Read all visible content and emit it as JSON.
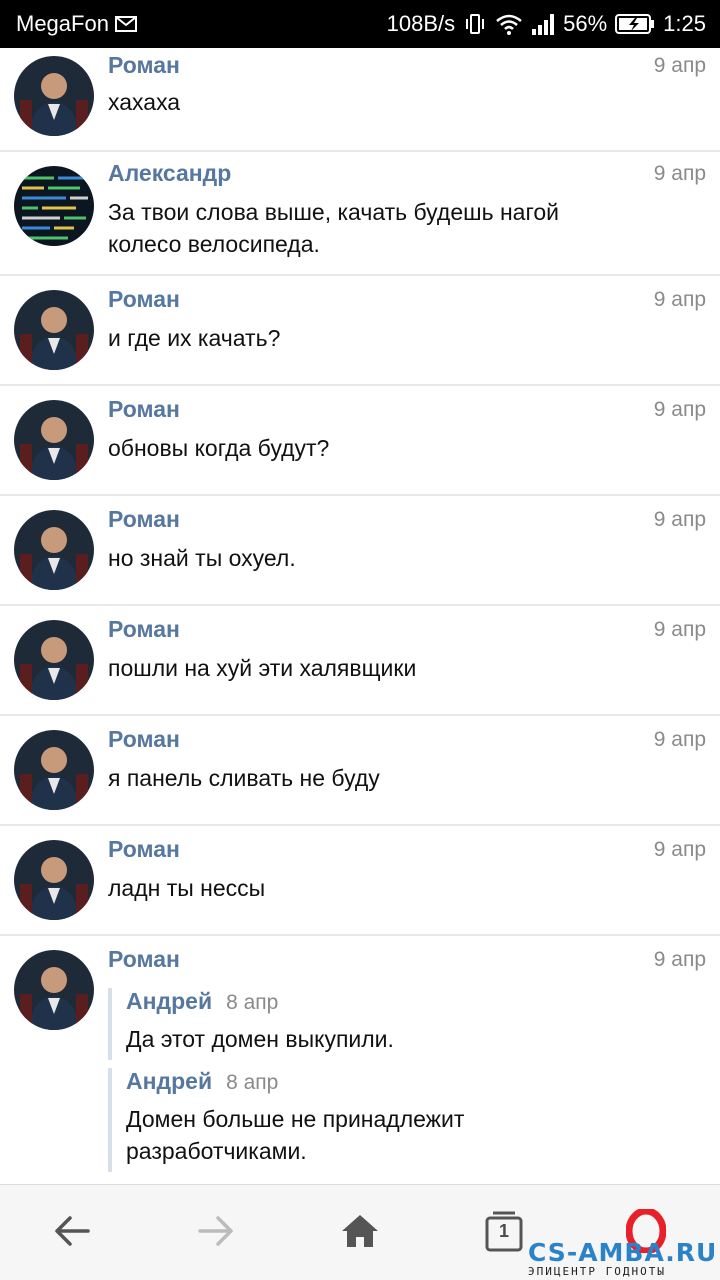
{
  "status_bar": {
    "carrier": "MegaFon",
    "speed": "108B/s",
    "battery": "56%",
    "time": "1:25"
  },
  "messages": [
    {
      "author": "Роман",
      "date": "9 апр",
      "text": "хахаха"
    },
    {
      "author": "Александр",
      "date": "9 апр",
      "text": "За твои слова выше, качать будешь нагой колесо велосипеда."
    },
    {
      "author": "Роман",
      "date": "9 апр",
      "text": "и где их качать?"
    },
    {
      "author": "Роман",
      "date": "9 апр",
      "text": "обновы когда будут?"
    },
    {
      "author": "Роман",
      "date": "9 апр",
      "text": "но знай ты охуел."
    },
    {
      "author": "Роман",
      "date": "9 апр",
      "text": "пошли на хуй эти халявщики"
    },
    {
      "author": "Роман",
      "date": "9 апр",
      "text": "я панель сливать не буду"
    },
    {
      "author": "Роман",
      "date": "9 апр",
      "text": "ладн ты нессы"
    },
    {
      "author": "Роман",
      "date": "9 апр",
      "quotes": [
        {
          "author": "Андрей",
          "date": "8 апр",
          "text": "Да этот домен выкупили."
        },
        {
          "author": "Андрей",
          "date": "8 апр",
          "text": "Домен больше не принадлежит разработчиками."
        }
      ]
    }
  ],
  "bottom_nav": {
    "tabs_count": "1",
    "browser_logo": "O"
  },
  "watermark": {
    "main": "CS-AMBA.RU",
    "sub": "ЭПИЦЕНТР ГОДНОТЫ"
  },
  "icons": [
    "mail-icon",
    "vibrate-icon",
    "wifi-icon",
    "signal-icon",
    "battery-icon",
    "back-arrow-icon",
    "forward-arrow-icon",
    "home-icon",
    "tabs-icon",
    "opera-logo-icon"
  ],
  "colors": {
    "author": "#56779f",
    "date": "#8a8a8a",
    "status_bar": "#000000",
    "quote_border": "#d7dfe8"
  }
}
